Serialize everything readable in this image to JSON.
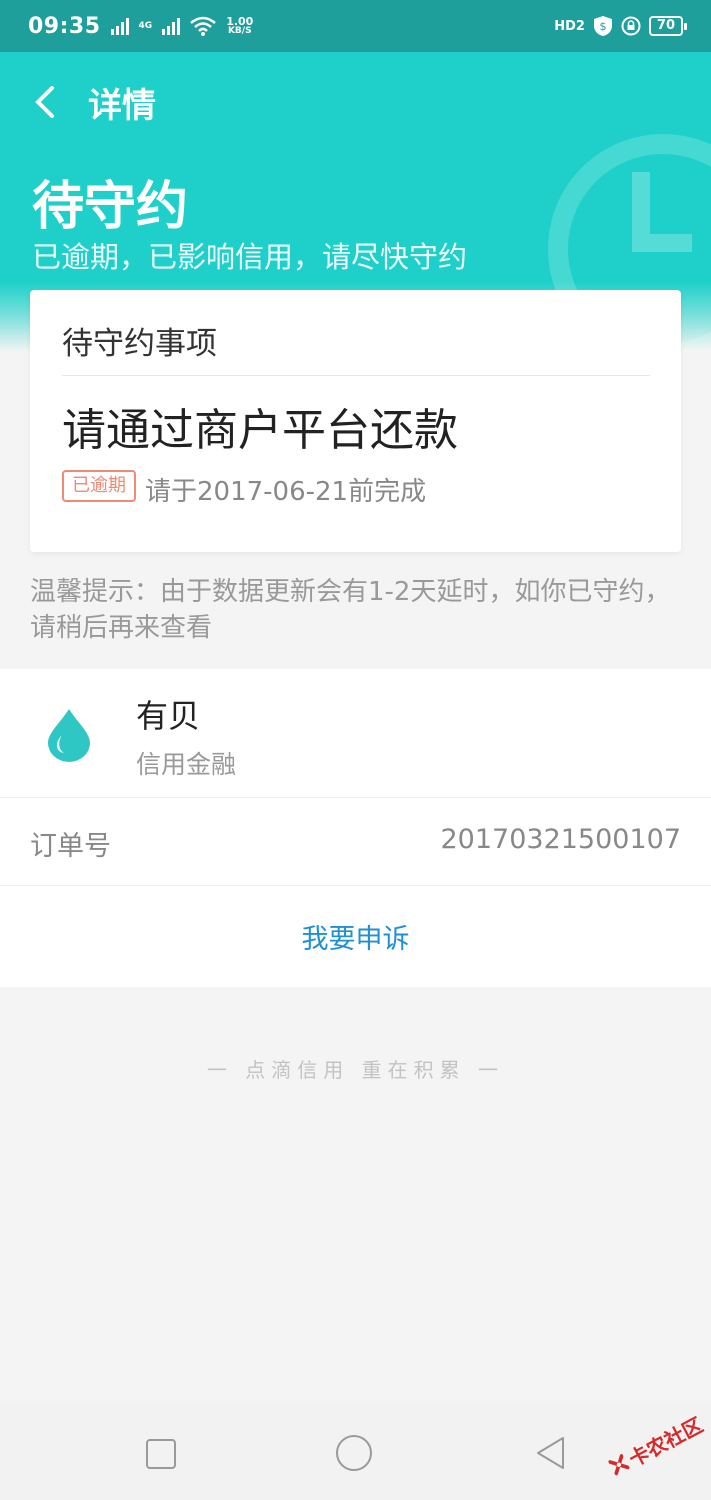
{
  "status_bar": {
    "time": "09:35",
    "network_type": "4G",
    "speed": "1.00",
    "speed_unit": "KB/S",
    "hd_badge": "HD2",
    "battery": "70"
  },
  "header": {
    "nav_title": "详情",
    "status_title": "待守约",
    "status_desc": "已逾期，已影响信用，请尽快守约"
  },
  "card": {
    "title": "待守约事项",
    "main_text": "请通过商户平台还款",
    "tag": "已逾期",
    "deadline": "请于2017-06-21前完成"
  },
  "tip": "温馨提示：由于数据更新会有1-2天延时，如你已守约，请稍后再来查看",
  "merchant": {
    "name": "有贝",
    "type": "信用金融"
  },
  "order": {
    "label": "订单号",
    "value": "20170321500107"
  },
  "appeal": {
    "label": "我要申诉"
  },
  "slogan": "一 点滴信用 重在积累 一",
  "watermark_logo": {
    "text": "卡农社区"
  },
  "colors": {
    "accent": "#1ed0c9",
    "status_bar": "#1f9f9b",
    "warning": "#ef8a74",
    "link": "#1f8fd6"
  }
}
